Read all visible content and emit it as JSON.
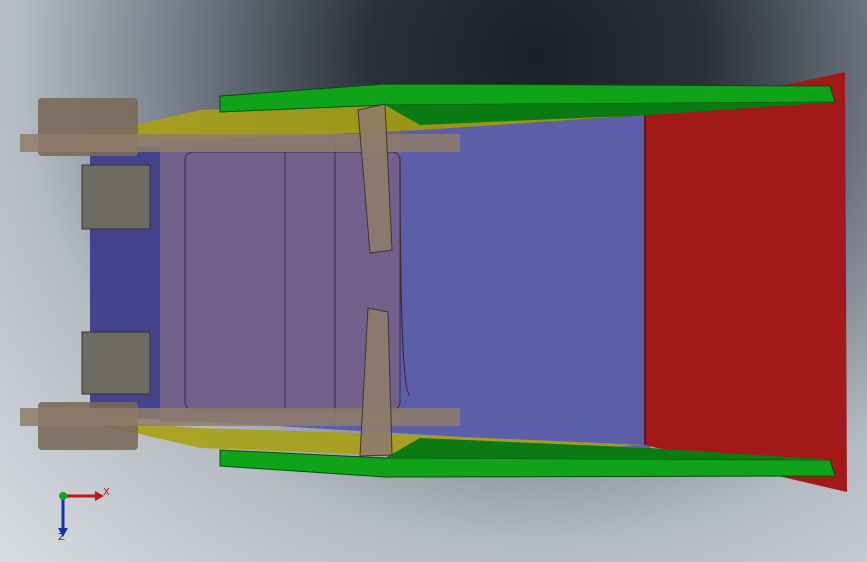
{
  "viewport": {
    "model_name_icon": "3d-cad-bucket-model",
    "background_top": "#1c1f26",
    "background_bottom": "#d9dde2"
  },
  "model": {
    "colors": {
      "floor_plate": "#5d5ea8",
      "floor_plate_dark": "#3f3f8a",
      "cutting_edge": "#a31818",
      "side_plate": "#0fa31a",
      "side_plate_dark": "#0a7a12",
      "reinforcement": "#a8a014",
      "bracket": "#8f7c6a",
      "hub": "#7a6a5a",
      "block": "#6e6a64",
      "back_box": "#7a6086"
    }
  },
  "triad": {
    "x_label": "X",
    "z_label": "Z",
    "x_color": "#c0151b",
    "y_color": "#13a818",
    "z_color": "#1a2fae"
  }
}
